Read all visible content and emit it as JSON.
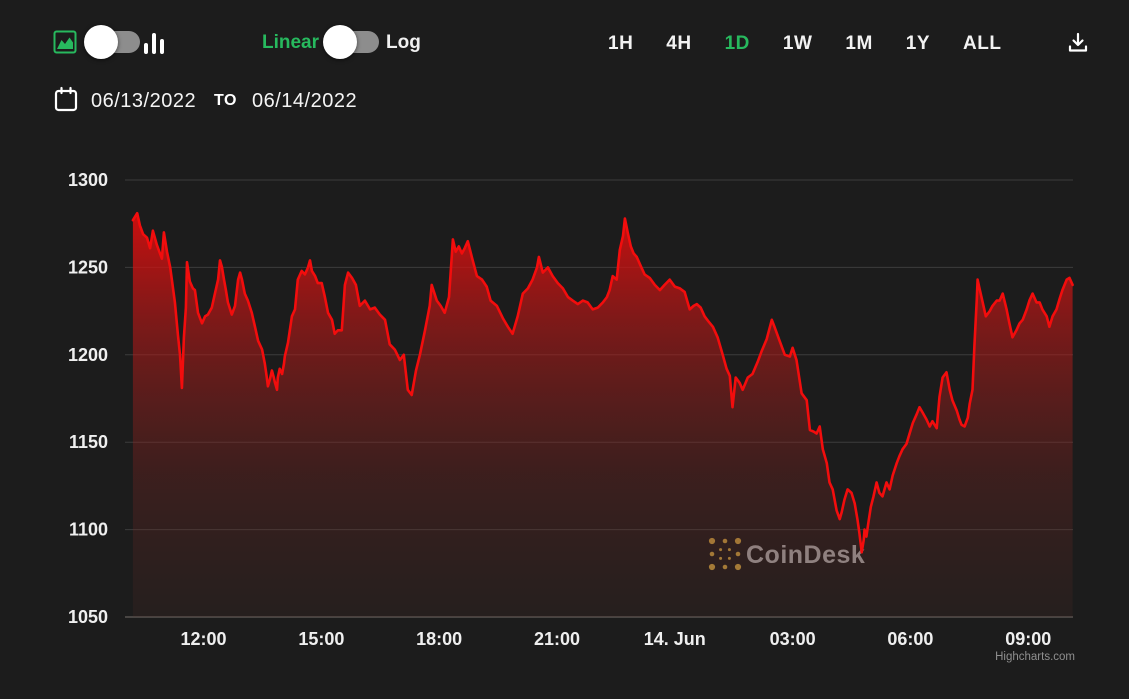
{
  "toolbar": {
    "chart_style_toggle": {
      "left_icon": "area-chart-icon",
      "right_icon": "bar-chart-icon",
      "state": "area"
    },
    "scale_toggle": {
      "left_label": "Linear",
      "right_label": "Log",
      "active": "Linear"
    },
    "ranges": [
      {
        "label": "1H",
        "active": false
      },
      {
        "label": "4H",
        "active": false
      },
      {
        "label": "1D",
        "active": true
      },
      {
        "label": "1W",
        "active": false
      },
      {
        "label": "1M",
        "active": false
      },
      {
        "label": "1Y",
        "active": false
      },
      {
        "label": "ALL",
        "active": false
      }
    ],
    "download_icon": "download-icon"
  },
  "date_range": {
    "start": "06/13/2022",
    "separator": "TO",
    "end": "06/14/2022"
  },
  "watermark": {
    "brand": "CoinDesk",
    "credit": "Highcharts.com"
  },
  "colors": {
    "background": "#1c1c1c",
    "accent_green": "#27b95e",
    "line_red": "#f20d0d",
    "grid": "#3c3c3c",
    "axis_line": "#575350",
    "label_text": "#efefef",
    "muted_text": "#9b9b9b",
    "logo_gold": "#b5913c"
  },
  "chart_data": {
    "type": "area",
    "title": "",
    "xlabel": "",
    "ylabel": "",
    "grid": true,
    "legend": false,
    "x_axis": {
      "unit": "hours after 2022-06-13 10:00",
      "lim": [
        0,
        24.14
      ],
      "ticks": [
        {
          "t": 2,
          "label": "12:00"
        },
        {
          "t": 5,
          "label": "15:00"
        },
        {
          "t": 8,
          "label": "18:00"
        },
        {
          "t": 11,
          "label": "21:00"
        },
        {
          "t": 14,
          "label": "14. Jun"
        },
        {
          "t": 17,
          "label": "03:00"
        },
        {
          "t": 20,
          "label": "06:00"
        },
        {
          "t": 23,
          "label": "09:00"
        }
      ]
    },
    "y_axis": {
      "lim": [
        1050,
        1300
      ],
      "ticks": [
        1300,
        1250,
        1200,
        1150,
        1100,
        1050
      ]
    },
    "series": [
      {
        "color": "#f20d0d",
        "points": [
          [
            0.2,
            1277
          ],
          [
            0.31,
            1281
          ],
          [
            0.38,
            1274
          ],
          [
            0.46,
            1269
          ],
          [
            0.56,
            1267
          ],
          [
            0.64,
            1261
          ],
          [
            0.71,
            1271
          ],
          [
            0.81,
            1263
          ],
          [
            0.94,
            1255
          ],
          [
            0.99,
            1270
          ],
          [
            1.07,
            1259
          ],
          [
            1.15,
            1250
          ],
          [
            1.2,
            1242
          ],
          [
            1.27,
            1230
          ],
          [
            1.35,
            1211
          ],
          [
            1.4,
            1200
          ],
          [
            1.45,
            1181
          ],
          [
            1.5,
            1210
          ],
          [
            1.55,
            1227
          ],
          [
            1.58,
            1253
          ],
          [
            1.65,
            1242
          ],
          [
            1.73,
            1238
          ],
          [
            1.78,
            1237
          ],
          [
            1.86,
            1224
          ],
          [
            1.96,
            1218
          ],
          [
            2.04,
            1222
          ],
          [
            2.11,
            1223
          ],
          [
            2.21,
            1227
          ],
          [
            2.29,
            1235
          ],
          [
            2.37,
            1243
          ],
          [
            2.42,
            1254
          ],
          [
            2.47,
            1250
          ],
          [
            2.52,
            1243
          ],
          [
            2.57,
            1237
          ],
          [
            2.62,
            1230
          ],
          [
            2.72,
            1223
          ],
          [
            2.8,
            1228
          ],
          [
            2.88,
            1243
          ],
          [
            2.93,
            1247
          ],
          [
            2.98,
            1243
          ],
          [
            3.05,
            1235
          ],
          [
            3.13,
            1231
          ],
          [
            3.23,
            1224
          ],
          [
            3.31,
            1216
          ],
          [
            3.39,
            1208
          ],
          [
            3.49,
            1203
          ],
          [
            3.56,
            1195
          ],
          [
            3.61,
            1187
          ],
          [
            3.64,
            1182
          ],
          [
            3.69,
            1186
          ],
          [
            3.74,
            1191
          ],
          [
            3.79,
            1187
          ],
          [
            3.82,
            1184
          ],
          [
            3.87,
            1180
          ],
          [
            3.89,
            1187
          ],
          [
            3.94,
            1192
          ],
          [
            4.0,
            1189
          ],
          [
            4.05,
            1195
          ],
          [
            4.07,
            1199
          ],
          [
            4.15,
            1207
          ],
          [
            4.25,
            1222
          ],
          [
            4.33,
            1226
          ],
          [
            4.4,
            1243
          ],
          [
            4.5,
            1248
          ],
          [
            4.58,
            1246
          ],
          [
            4.66,
            1250
          ],
          [
            4.71,
            1254
          ],
          [
            4.76,
            1248
          ],
          [
            4.84,
            1245
          ],
          [
            4.91,
            1241
          ],
          [
            5.01,
            1241
          ],
          [
            5.09,
            1233
          ],
          [
            5.17,
            1224
          ],
          [
            5.27,
            1220
          ],
          [
            5.34,
            1212
          ],
          [
            5.42,
            1214
          ],
          [
            5.52,
            1214
          ],
          [
            5.6,
            1240
          ],
          [
            5.68,
            1247
          ],
          [
            5.78,
            1244
          ],
          [
            5.88,
            1240
          ],
          [
            5.98,
            1228
          ],
          [
            6.11,
            1231
          ],
          [
            6.24,
            1226
          ],
          [
            6.36,
            1227
          ],
          [
            6.49,
            1223
          ],
          [
            6.62,
            1220
          ],
          [
            6.74,
            1206
          ],
          [
            6.87,
            1203
          ],
          [
            7.0,
            1197
          ],
          [
            7.1,
            1200
          ],
          [
            7.2,
            1180
          ],
          [
            7.3,
            1177
          ],
          [
            7.41,
            1191
          ],
          [
            7.51,
            1200
          ],
          [
            7.64,
            1214
          ],
          [
            7.76,
            1228
          ],
          [
            7.81,
            1240
          ],
          [
            7.94,
            1231
          ],
          [
            8.04,
            1228
          ],
          [
            8.14,
            1224
          ],
          [
            8.25,
            1233
          ],
          [
            8.35,
            1266
          ],
          [
            8.42,
            1259
          ],
          [
            8.5,
            1262
          ],
          [
            8.58,
            1258
          ],
          [
            8.65,
            1261
          ],
          [
            8.73,
            1265
          ],
          [
            8.83,
            1256
          ],
          [
            8.96,
            1245
          ],
          [
            9.09,
            1243
          ],
          [
            9.21,
            1239
          ],
          [
            9.31,
            1231
          ],
          [
            9.47,
            1228
          ],
          [
            9.62,
            1221
          ],
          [
            9.75,
            1216
          ],
          [
            9.87,
            1212
          ],
          [
            10.0,
            1222
          ],
          [
            10.13,
            1235
          ],
          [
            10.26,
            1238
          ],
          [
            10.38,
            1243
          ],
          [
            10.49,
            1250
          ],
          [
            10.54,
            1256
          ],
          [
            10.64,
            1247
          ],
          [
            10.77,
            1250
          ],
          [
            10.89,
            1245
          ],
          [
            11.02,
            1241
          ],
          [
            11.15,
            1238
          ],
          [
            11.28,
            1233
          ],
          [
            11.4,
            1231
          ],
          [
            11.53,
            1229
          ],
          [
            11.66,
            1231
          ],
          [
            11.78,
            1230
          ],
          [
            11.91,
            1226
          ],
          [
            12.04,
            1227
          ],
          [
            12.17,
            1230
          ],
          [
            12.27,
            1233
          ],
          [
            12.34,
            1237
          ],
          [
            12.42,
            1245
          ],
          [
            12.52,
            1243
          ],
          [
            12.6,
            1260
          ],
          [
            12.68,
            1268
          ],
          [
            12.73,
            1278
          ],
          [
            12.8,
            1270
          ],
          [
            12.88,
            1262
          ],
          [
            12.95,
            1258
          ],
          [
            13.03,
            1256
          ],
          [
            13.13,
            1251
          ],
          [
            13.23,
            1246
          ],
          [
            13.36,
            1244
          ],
          [
            13.49,
            1240
          ],
          [
            13.62,
            1237
          ],
          [
            13.74,
            1240
          ],
          [
            13.87,
            1243
          ],
          [
            14.0,
            1239
          ],
          [
            14.13,
            1238
          ],
          [
            14.25,
            1236
          ],
          [
            14.38,
            1226
          ],
          [
            14.48,
            1228
          ],
          [
            14.56,
            1229
          ],
          [
            14.66,
            1227
          ],
          [
            14.76,
            1222
          ],
          [
            14.86,
            1219
          ],
          [
            14.97,
            1216
          ],
          [
            15.09,
            1210
          ],
          [
            15.22,
            1200
          ],
          [
            15.32,
            1192
          ],
          [
            15.4,
            1188
          ],
          [
            15.47,
            1170
          ],
          [
            15.55,
            1187
          ],
          [
            15.65,
            1184
          ],
          [
            15.73,
            1180
          ],
          [
            15.86,
            1187
          ],
          [
            15.98,
            1189
          ],
          [
            16.11,
            1196
          ],
          [
            16.21,
            1202
          ],
          [
            16.34,
            1209
          ],
          [
            16.47,
            1220
          ],
          [
            16.54,
            1216
          ],
          [
            16.67,
            1208
          ],
          [
            16.8,
            1200
          ],
          [
            16.93,
            1199
          ],
          [
            17.0,
            1204
          ],
          [
            17.1,
            1197
          ],
          [
            17.23,
            1178
          ],
          [
            17.36,
            1174
          ],
          [
            17.44,
            1157
          ],
          [
            17.54,
            1156
          ],
          [
            17.61,
            1155
          ],
          [
            17.69,
            1159
          ],
          [
            17.77,
            1146
          ],
          [
            17.87,
            1138
          ],
          [
            17.94,
            1127
          ],
          [
            18.02,
            1123
          ],
          [
            18.12,
            1111
          ],
          [
            18.2,
            1106
          ],
          [
            18.25,
            1110
          ],
          [
            18.32,
            1117
          ],
          [
            18.4,
            1123
          ],
          [
            18.5,
            1121
          ],
          [
            18.58,
            1115
          ],
          [
            18.65,
            1106
          ],
          [
            18.7,
            1098
          ],
          [
            18.76,
            1087
          ],
          [
            18.81,
            1094
          ],
          [
            18.83,
            1100
          ],
          [
            18.88,
            1096
          ],
          [
            18.93,
            1104
          ],
          [
            18.99,
            1113
          ],
          [
            19.06,
            1119
          ],
          [
            19.14,
            1127
          ],
          [
            19.21,
            1121
          ],
          [
            19.29,
            1119
          ],
          [
            19.39,
            1127
          ],
          [
            19.47,
            1123
          ],
          [
            19.55,
            1131
          ],
          [
            19.65,
            1138
          ],
          [
            19.72,
            1142
          ],
          [
            19.8,
            1146
          ],
          [
            19.9,
            1149
          ],
          [
            19.98,
            1155
          ],
          [
            20.06,
            1161
          ],
          [
            20.16,
            1166
          ],
          [
            20.23,
            1170
          ],
          [
            20.31,
            1167
          ],
          [
            20.41,
            1163
          ],
          [
            20.49,
            1159
          ],
          [
            20.56,
            1162
          ],
          [
            20.67,
            1158
          ],
          [
            20.74,
            1176
          ],
          [
            20.82,
            1187
          ],
          [
            20.92,
            1190
          ],
          [
            21.0,
            1180
          ],
          [
            21.07,
            1174
          ],
          [
            21.18,
            1168
          ],
          [
            21.25,
            1163
          ],
          [
            21.3,
            1160
          ],
          [
            21.38,
            1159
          ],
          [
            21.46,
            1164
          ],
          [
            21.51,
            1172
          ],
          [
            21.58,
            1180
          ],
          [
            21.63,
            1205
          ],
          [
            21.69,
            1232
          ],
          [
            21.71,
            1243
          ],
          [
            21.76,
            1238
          ],
          [
            21.84,
            1230
          ],
          [
            21.92,
            1222
          ],
          [
            22.02,
            1225
          ],
          [
            22.09,
            1228
          ],
          [
            22.2,
            1231
          ],
          [
            22.27,
            1231
          ],
          [
            22.35,
            1235
          ],
          [
            22.45,
            1226
          ],
          [
            22.52,
            1218
          ],
          [
            22.6,
            1210
          ],
          [
            22.7,
            1214
          ],
          [
            22.78,
            1218
          ],
          [
            22.86,
            1220
          ],
          [
            22.96,
            1226
          ],
          [
            23.03,
            1231
          ],
          [
            23.11,
            1235
          ],
          [
            23.21,
            1230
          ],
          [
            23.29,
            1230
          ],
          [
            23.36,
            1226
          ],
          [
            23.47,
            1222
          ],
          [
            23.54,
            1216
          ],
          [
            23.62,
            1222
          ],
          [
            23.72,
            1226
          ],
          [
            23.8,
            1232
          ],
          [
            23.87,
            1237
          ],
          [
            23.98,
            1243
          ],
          [
            24.05,
            1244
          ],
          [
            24.13,
            1240
          ]
        ]
      }
    ]
  }
}
